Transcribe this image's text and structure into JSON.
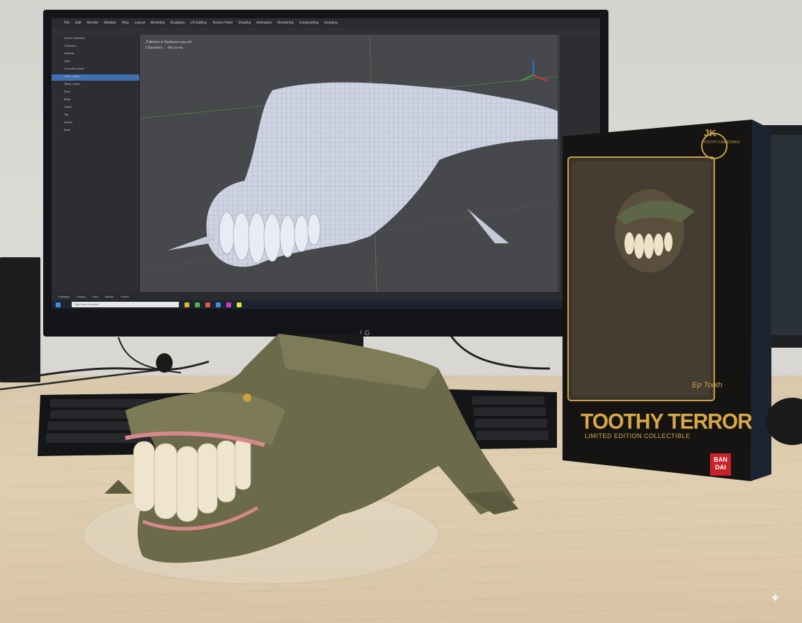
{
  "scene": {
    "monitor_brand": "LG",
    "viewport_header": "Z'afemoo is Ganhusm eau aS",
    "viewport_subheader": "Characters ← fon-oc-eo",
    "menu_items": [
      "File",
      "Edit",
      "Render",
      "Window",
      "Help",
      "Layout",
      "Modeling",
      "Sculpting",
      "UV Editing",
      "Texture Paint",
      "Shading",
      "Animation",
      "Rendering",
      "Compositing",
      "Scripting"
    ],
    "outliner_rows": [
      "Scene Collection",
      "Collection",
      "Camera",
      "Light",
      "Crocodile_Mesh",
      "Teeth_Upper",
      "Teeth_Lower",
      "Eyes",
      "Body",
      "Claws",
      "Tail",
      "Scales",
      "Base"
    ],
    "selected_row_index": 5,
    "timeline_items": [
      "Playback",
      "Keying",
      "View",
      "Marker",
      "Frame"
    ],
    "taskbar_search": "Type here to search"
  },
  "box": {
    "logo_text": "JK",
    "logo_sub": "TOOTHY CREATURES",
    "title": "TOOTHY TERROR",
    "subtitle": "LIMITED EDITION COLLECTIBLE",
    "brand_badge_line1": "BAN",
    "brand_badge_line2": "DAI",
    "signature": "Ep Tooth"
  },
  "colors": {
    "box_gold": "#d8a746",
    "box_black": "#151412",
    "selection_blue": "#3f6fb0",
    "crocodile_green": "#6b6a4a",
    "desk_wood": "#dccbad"
  }
}
